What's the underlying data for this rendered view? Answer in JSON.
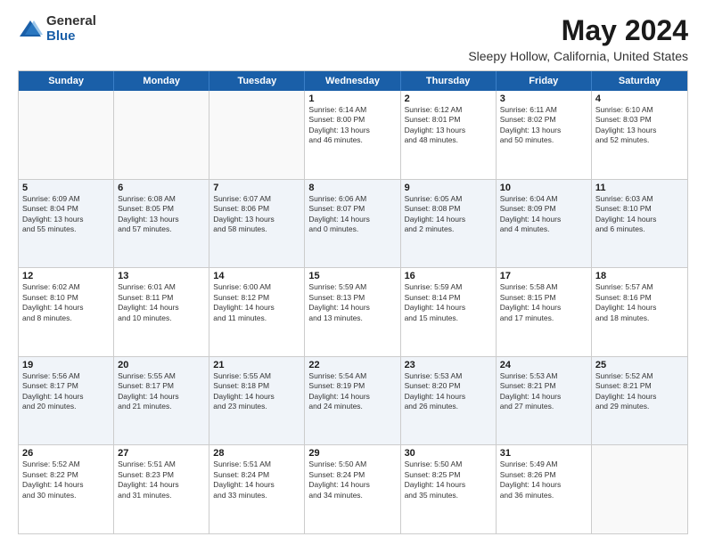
{
  "logo": {
    "general": "General",
    "blue": "Blue"
  },
  "title": "May 2024",
  "subtitle": "Sleepy Hollow, California, United States",
  "header_days": [
    "Sunday",
    "Monday",
    "Tuesday",
    "Wednesday",
    "Thursday",
    "Friday",
    "Saturday"
  ],
  "weeks": [
    {
      "cells": [
        {
          "day": "",
          "info": "",
          "empty": true
        },
        {
          "day": "",
          "info": "",
          "empty": true
        },
        {
          "day": "",
          "info": "",
          "empty": true
        },
        {
          "day": "1",
          "info": "Sunrise: 6:14 AM\nSunset: 8:00 PM\nDaylight: 13 hours\nand 46 minutes.",
          "empty": false
        },
        {
          "day": "2",
          "info": "Sunrise: 6:12 AM\nSunset: 8:01 PM\nDaylight: 13 hours\nand 48 minutes.",
          "empty": false
        },
        {
          "day": "3",
          "info": "Sunrise: 6:11 AM\nSunset: 8:02 PM\nDaylight: 13 hours\nand 50 minutes.",
          "empty": false
        },
        {
          "day": "4",
          "info": "Sunrise: 6:10 AM\nSunset: 8:03 PM\nDaylight: 13 hours\nand 52 minutes.",
          "empty": false
        }
      ]
    },
    {
      "cells": [
        {
          "day": "5",
          "info": "Sunrise: 6:09 AM\nSunset: 8:04 PM\nDaylight: 13 hours\nand 55 minutes.",
          "empty": false
        },
        {
          "day": "6",
          "info": "Sunrise: 6:08 AM\nSunset: 8:05 PM\nDaylight: 13 hours\nand 57 minutes.",
          "empty": false
        },
        {
          "day": "7",
          "info": "Sunrise: 6:07 AM\nSunset: 8:06 PM\nDaylight: 13 hours\nand 58 minutes.",
          "empty": false
        },
        {
          "day": "8",
          "info": "Sunrise: 6:06 AM\nSunset: 8:07 PM\nDaylight: 14 hours\nand 0 minutes.",
          "empty": false
        },
        {
          "day": "9",
          "info": "Sunrise: 6:05 AM\nSunset: 8:08 PM\nDaylight: 14 hours\nand 2 minutes.",
          "empty": false
        },
        {
          "day": "10",
          "info": "Sunrise: 6:04 AM\nSunset: 8:09 PM\nDaylight: 14 hours\nand 4 minutes.",
          "empty": false
        },
        {
          "day": "11",
          "info": "Sunrise: 6:03 AM\nSunset: 8:10 PM\nDaylight: 14 hours\nand 6 minutes.",
          "empty": false
        }
      ]
    },
    {
      "cells": [
        {
          "day": "12",
          "info": "Sunrise: 6:02 AM\nSunset: 8:10 PM\nDaylight: 14 hours\nand 8 minutes.",
          "empty": false
        },
        {
          "day": "13",
          "info": "Sunrise: 6:01 AM\nSunset: 8:11 PM\nDaylight: 14 hours\nand 10 minutes.",
          "empty": false
        },
        {
          "day": "14",
          "info": "Sunrise: 6:00 AM\nSunset: 8:12 PM\nDaylight: 14 hours\nand 11 minutes.",
          "empty": false
        },
        {
          "day": "15",
          "info": "Sunrise: 5:59 AM\nSunset: 8:13 PM\nDaylight: 14 hours\nand 13 minutes.",
          "empty": false
        },
        {
          "day": "16",
          "info": "Sunrise: 5:59 AM\nSunset: 8:14 PM\nDaylight: 14 hours\nand 15 minutes.",
          "empty": false
        },
        {
          "day": "17",
          "info": "Sunrise: 5:58 AM\nSunset: 8:15 PM\nDaylight: 14 hours\nand 17 minutes.",
          "empty": false
        },
        {
          "day": "18",
          "info": "Sunrise: 5:57 AM\nSunset: 8:16 PM\nDaylight: 14 hours\nand 18 minutes.",
          "empty": false
        }
      ]
    },
    {
      "cells": [
        {
          "day": "19",
          "info": "Sunrise: 5:56 AM\nSunset: 8:17 PM\nDaylight: 14 hours\nand 20 minutes.",
          "empty": false
        },
        {
          "day": "20",
          "info": "Sunrise: 5:55 AM\nSunset: 8:17 PM\nDaylight: 14 hours\nand 21 minutes.",
          "empty": false
        },
        {
          "day": "21",
          "info": "Sunrise: 5:55 AM\nSunset: 8:18 PM\nDaylight: 14 hours\nand 23 minutes.",
          "empty": false
        },
        {
          "day": "22",
          "info": "Sunrise: 5:54 AM\nSunset: 8:19 PM\nDaylight: 14 hours\nand 24 minutes.",
          "empty": false
        },
        {
          "day": "23",
          "info": "Sunrise: 5:53 AM\nSunset: 8:20 PM\nDaylight: 14 hours\nand 26 minutes.",
          "empty": false
        },
        {
          "day": "24",
          "info": "Sunrise: 5:53 AM\nSunset: 8:21 PM\nDaylight: 14 hours\nand 27 minutes.",
          "empty": false
        },
        {
          "day": "25",
          "info": "Sunrise: 5:52 AM\nSunset: 8:21 PM\nDaylight: 14 hours\nand 29 minutes.",
          "empty": false
        }
      ]
    },
    {
      "cells": [
        {
          "day": "26",
          "info": "Sunrise: 5:52 AM\nSunset: 8:22 PM\nDaylight: 14 hours\nand 30 minutes.",
          "empty": false
        },
        {
          "day": "27",
          "info": "Sunrise: 5:51 AM\nSunset: 8:23 PM\nDaylight: 14 hours\nand 31 minutes.",
          "empty": false
        },
        {
          "day": "28",
          "info": "Sunrise: 5:51 AM\nSunset: 8:24 PM\nDaylight: 14 hours\nand 33 minutes.",
          "empty": false
        },
        {
          "day": "29",
          "info": "Sunrise: 5:50 AM\nSunset: 8:24 PM\nDaylight: 14 hours\nand 34 minutes.",
          "empty": false
        },
        {
          "day": "30",
          "info": "Sunrise: 5:50 AM\nSunset: 8:25 PM\nDaylight: 14 hours\nand 35 minutes.",
          "empty": false
        },
        {
          "day": "31",
          "info": "Sunrise: 5:49 AM\nSunset: 8:26 PM\nDaylight: 14 hours\nand 36 minutes.",
          "empty": false
        },
        {
          "day": "",
          "info": "",
          "empty": true
        }
      ]
    }
  ]
}
